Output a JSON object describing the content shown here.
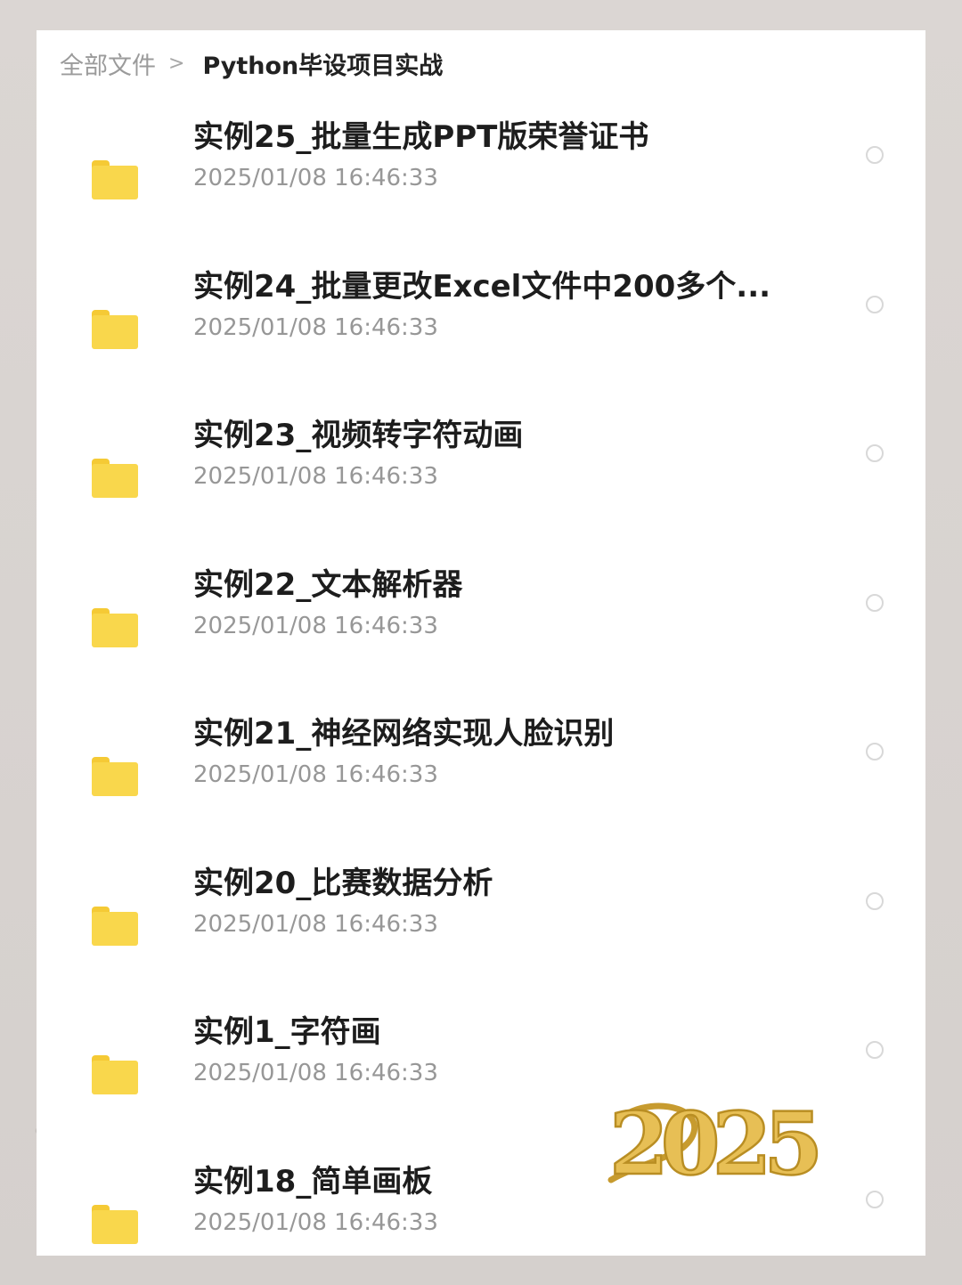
{
  "breadcrumb": {
    "root": "全部文件",
    "separator": ">",
    "current": "Python毕设项目实战"
  },
  "files": [
    {
      "name": "实例25_批量生成PPT版荣誉证书",
      "time": "2025/01/08 16:46:33"
    },
    {
      "name": "实例24_批量更改Excel文件中200多个...",
      "time": "2025/01/08 16:46:33"
    },
    {
      "name": "实例23_视频转字符动画",
      "time": "2025/01/08 16:46:33"
    },
    {
      "name": "实例22_文本解析器",
      "time": "2025/01/08 16:46:33"
    },
    {
      "name": "实例21_神经网络实现人脸识别",
      "time": "2025/01/08 16:46:33"
    },
    {
      "name": "实例20_比赛数据分析",
      "time": "2025/01/08 16:46:33"
    },
    {
      "name": "实例1_字符画",
      "time": "2025/01/08 16:46:33"
    },
    {
      "name": "实例18_简单画板",
      "time": "2025/01/08 16:46:33"
    }
  ],
  "icons": {
    "folder": "folder-icon",
    "select": "radio-unselected-icon",
    "separator": "chevron-right-icon"
  },
  "logo": {
    "text": "2025"
  },
  "colors": {
    "folder": "#f9d74c",
    "folder_tab": "#f5ca35",
    "title": "#1d1d1d",
    "timestamp": "#979797",
    "radio": "#d8d8d8",
    "logo_gold": "#e7bf55"
  }
}
